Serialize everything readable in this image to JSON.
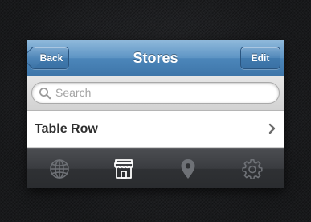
{
  "navbar": {
    "title": "Stores",
    "back_label": "Back",
    "edit_label": "Edit"
  },
  "search": {
    "placeholder": "Search",
    "icon": "search-icon"
  },
  "table": {
    "rows": [
      {
        "label": "Table Row",
        "accessory": "chevron-right-icon"
      }
    ]
  },
  "tabbar": {
    "tabs": [
      {
        "icon": "globe-icon",
        "selected": false
      },
      {
        "icon": "store-icon",
        "selected": true
      },
      {
        "icon": "location-pin-icon",
        "selected": false
      },
      {
        "icon": "gear-icon",
        "selected": false
      }
    ]
  },
  "colors": {
    "nav_blue": "#4c86ba",
    "tabbar_dark": "#2f3134",
    "tab_icon_inactive": "#6e7176",
    "tab_icon_selected": "#ffffff"
  }
}
